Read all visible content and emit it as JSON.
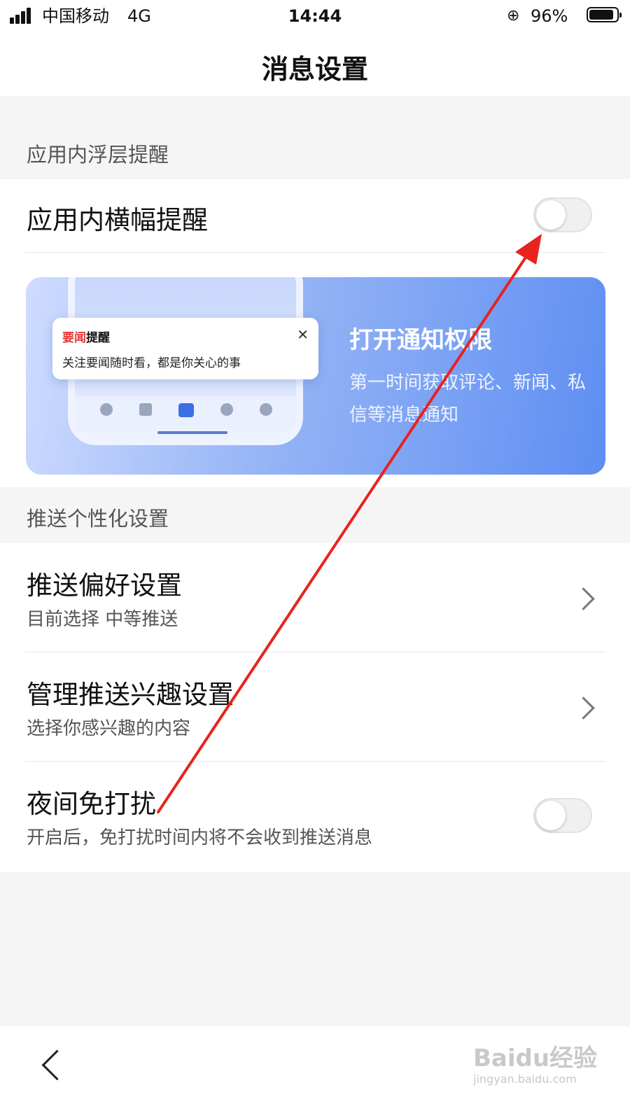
{
  "status_bar": {
    "carrier": "中国移动",
    "network": "4G",
    "time": "14:44",
    "battery": "96%"
  },
  "nav": {
    "title": "消息设置"
  },
  "section_overlay": {
    "header": "应用内浮层提醒",
    "banner_row": {
      "label": "应用内横幅提醒",
      "enabled": false
    }
  },
  "banner": {
    "notif_title_red": "要闻",
    "notif_title": "提醒",
    "notif_text": "关注要闻随时看，都是你关心的事",
    "title": "打开通知权限",
    "subtitle": "第一时间获取评论、新闻、私信等消息通知"
  },
  "section_push": {
    "header": "推送个性化设置",
    "items": [
      {
        "title": "推送偏好设置",
        "subtitle": "目前选择 中等推送"
      },
      {
        "title": "管理推送兴趣设置",
        "subtitle": "选择你感兴趣的内容"
      },
      {
        "title": "夜间免打扰",
        "subtitle": "开启后，免打扰时间内将不会收到推送消息",
        "enabled": false
      }
    ]
  },
  "watermark": {
    "brand": "Baidu经验",
    "url": "jingyan.baidu.com"
  },
  "colors": {
    "annotation_arrow": "#e8231e",
    "banner_blue": "#5e8ef2"
  }
}
